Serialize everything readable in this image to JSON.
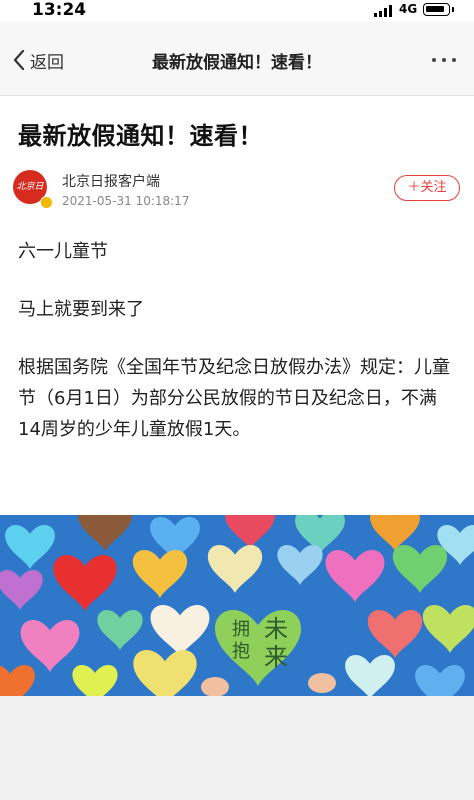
{
  "status_bar": {
    "time": "13:24",
    "network": "4G",
    "battery_level_pct": 85
  },
  "nav": {
    "back_label": "返回",
    "title": "最新放假通知！速看！",
    "more_icon": "more-dots-icon"
  },
  "article": {
    "title": "最新放假通知！速看！",
    "author": {
      "logo_text": "北京日报",
      "name": "北京日报客户端",
      "time": "2021-05-31 10:18:17"
    },
    "follow_label": "＋关注",
    "paragraphs": [
      "六一儿童节",
      "马上就要到来了",
      "根据国务院《全国年节及纪念日放假办法》规定：儿童节（6月1日）为部分公民放假的节日及纪念日，不满14周岁的少年儿童放假1天。"
    ],
    "photo": {
      "heart_text_1": "拥抱",
      "heart_text_2": "未来"
    }
  },
  "colors": {
    "accent": "#e8413c",
    "brand_red": "#d62b1f",
    "photo_bg": "#2f77c8"
  }
}
